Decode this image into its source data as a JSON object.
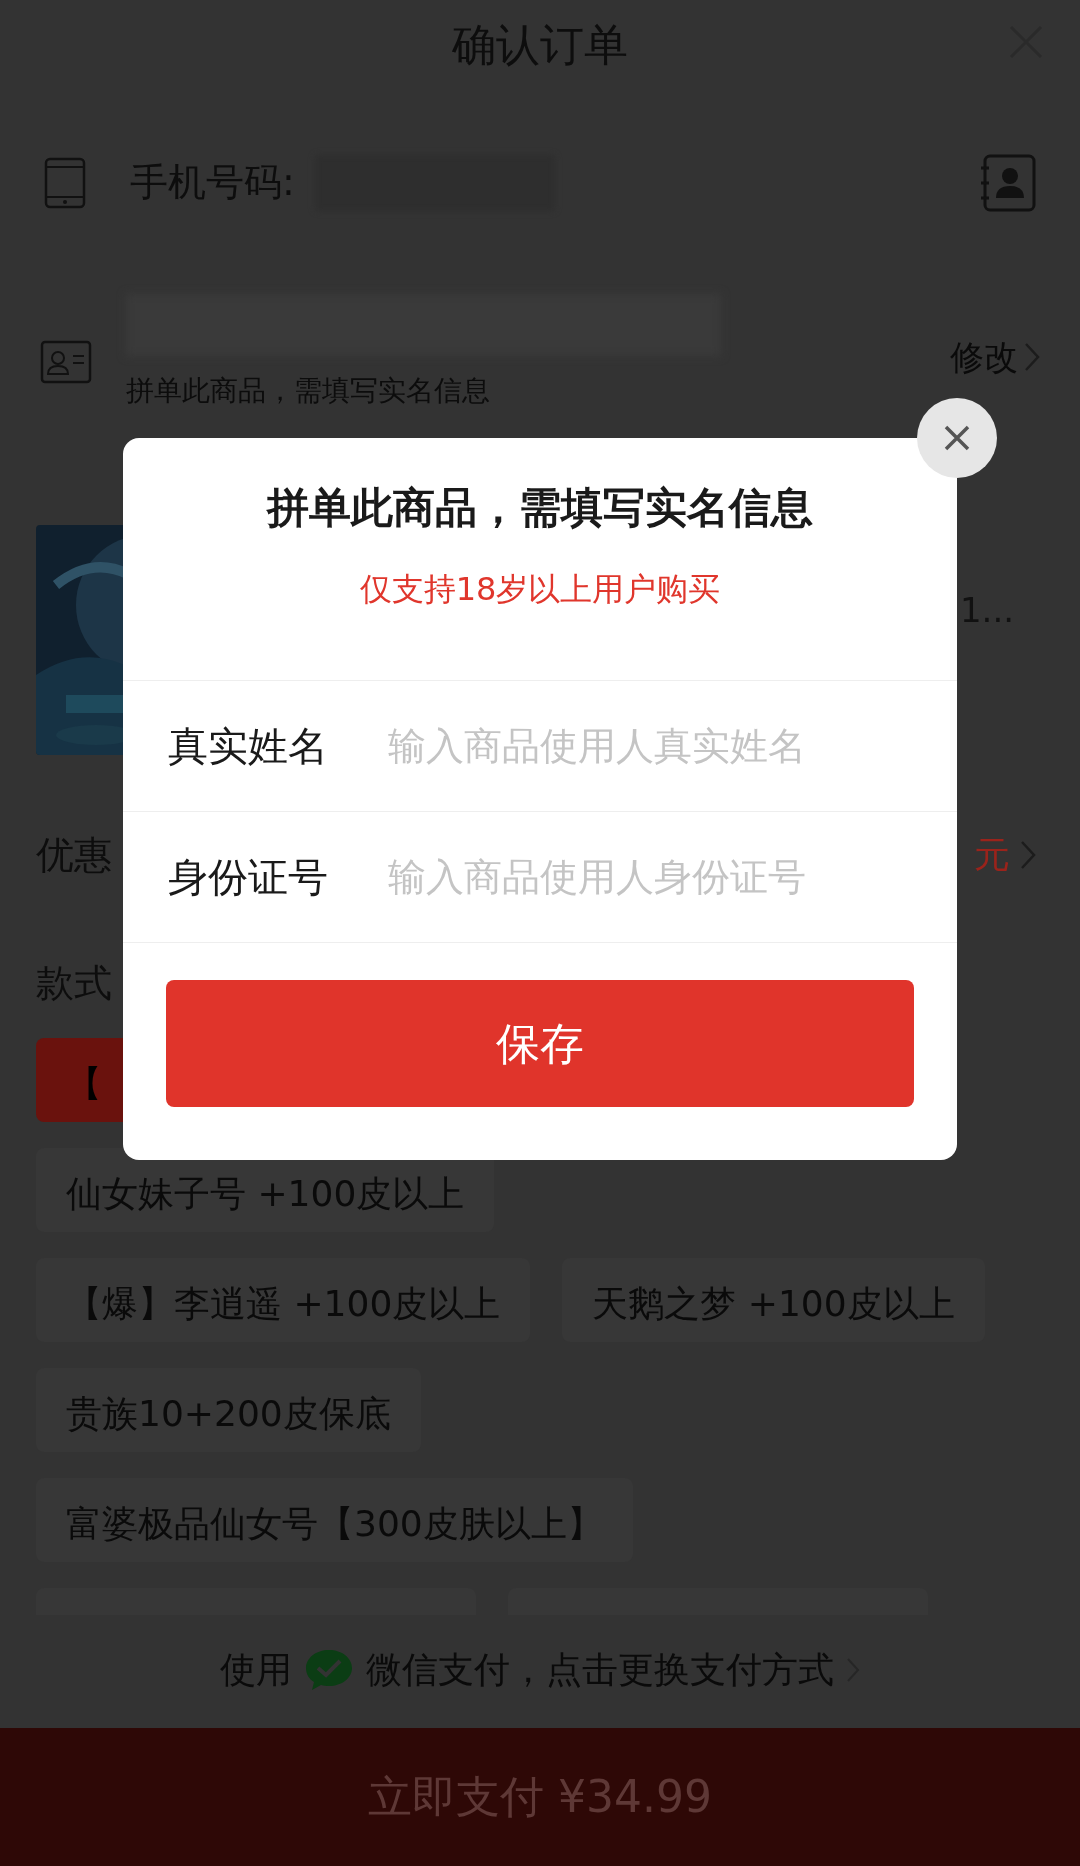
{
  "header": {
    "title": "确认订单"
  },
  "phone": {
    "label": "手机号码:"
  },
  "address": {
    "note": "拼单此商品，需填写实名信息",
    "edit": "修改"
  },
  "product": {
    "price_fragment": "1..."
  },
  "discount": {
    "label": "优惠",
    "value": "元"
  },
  "styles": {
    "label": "款式",
    "options": [
      {
        "label": "【",
        "selected": true
      },
      {
        "label": "仙女妹子号 +100皮以上",
        "selected": false
      },
      {
        "label": "【爆】李逍遥 +100皮以上",
        "selected": false
      },
      {
        "label": "天鹅之梦 +100皮以上",
        "selected": false
      },
      {
        "label": "贵族10+200皮保底",
        "selected": false
      },
      {
        "label": "富婆极品仙女号【300皮肤以上】",
        "selected": false
      }
    ]
  },
  "payment": {
    "prefix": "使用",
    "method": "微信支付，点击更换支付方式"
  },
  "pay_button": {
    "label": "立即支付 ¥34.99"
  },
  "dialog": {
    "title": "拼单此商品，需填写实名信息",
    "notice": "仅支持18岁以上用户购买",
    "fields": [
      {
        "label": "真实姓名",
        "placeholder": "输入商品使用人真实姓名"
      },
      {
        "label": "身份证号",
        "placeholder": "输入商品使用人身份证号"
      }
    ],
    "save": "保存"
  }
}
